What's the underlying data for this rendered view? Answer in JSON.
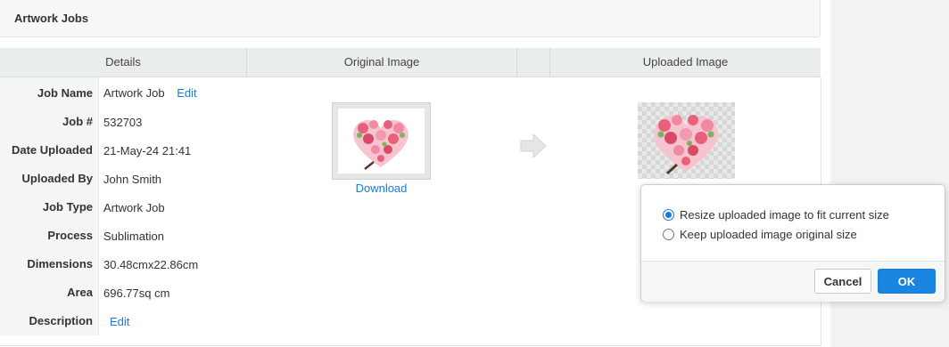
{
  "panel": {
    "title": "Artwork Jobs"
  },
  "table": {
    "headers": [
      "Details",
      "Original Image",
      "",
      "Uploaded Image"
    ]
  },
  "details": [
    {
      "label": "Job Name",
      "value": "Artwork Job",
      "link": "Edit"
    },
    {
      "label": "Job #",
      "value": "532703"
    },
    {
      "label": "Date Uploaded",
      "value": "21-May-24 21:41"
    },
    {
      "label": "Uploaded By",
      "value": "John Smith"
    },
    {
      "label": "Job Type",
      "value": "Artwork Job"
    },
    {
      "label": "Process",
      "value": "Sublimation"
    },
    {
      "label": "Dimensions",
      "value": "30.48cmx22.86cm"
    },
    {
      "label": "Area",
      "value": "696.77sq cm"
    },
    {
      "label": "Description",
      "link": "Edit"
    }
  ],
  "original_image": {
    "download_label": "Download",
    "icon": "heart-flowers-image"
  },
  "uploaded_image": {
    "icon": "heart-flowers-image"
  },
  "popover": {
    "options": [
      {
        "label": "Resize uploaded image to fit current size",
        "checked": true
      },
      {
        "label": "Keep uploaded image original size",
        "checked": false
      }
    ],
    "cancel_label": "Cancel",
    "ok_label": "OK"
  },
  "colors": {
    "accent": "#1a85e0",
    "link": "#1a7bd8",
    "heart": "#e8617a"
  }
}
